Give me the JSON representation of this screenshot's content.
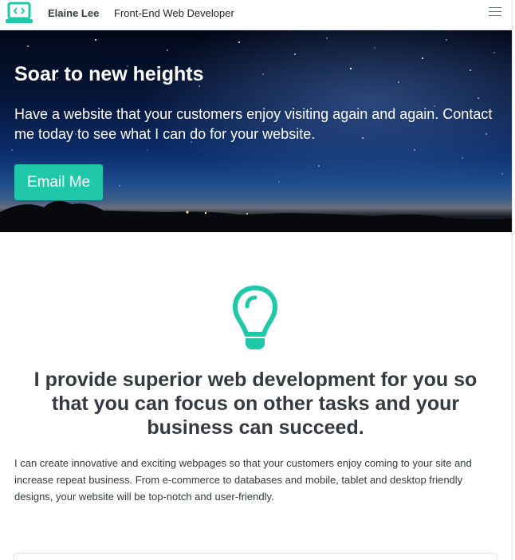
{
  "navbar": {
    "brand_name": "Elaine Lee",
    "tagline": "Front-End Web Developer",
    "brand_icon": "laptop-code-icon",
    "menu_icon": "hamburger-menu-icon"
  },
  "hero": {
    "title": "Soar to new heights",
    "text": "Have a website that your customers enjoy visiting again and again. Contact me today to see what I can do for your website.",
    "button_label": "Email Me"
  },
  "feature": {
    "icon": "lightbulb-icon",
    "heading": "I provide superior web development for you so that you can focus on other tasks and your business can succeed.",
    "text": "I can create innovative and exciting webpages so that your customers enjoy coming to your site and increase repeat business. From e-commerce to databases and mobile, tablet and desktop friendly designs, your website will be top-notch and user-friendly."
  },
  "colors": {
    "accent": "#1fc8a8",
    "text": "#343a40",
    "hero_sky": "#06163a"
  }
}
